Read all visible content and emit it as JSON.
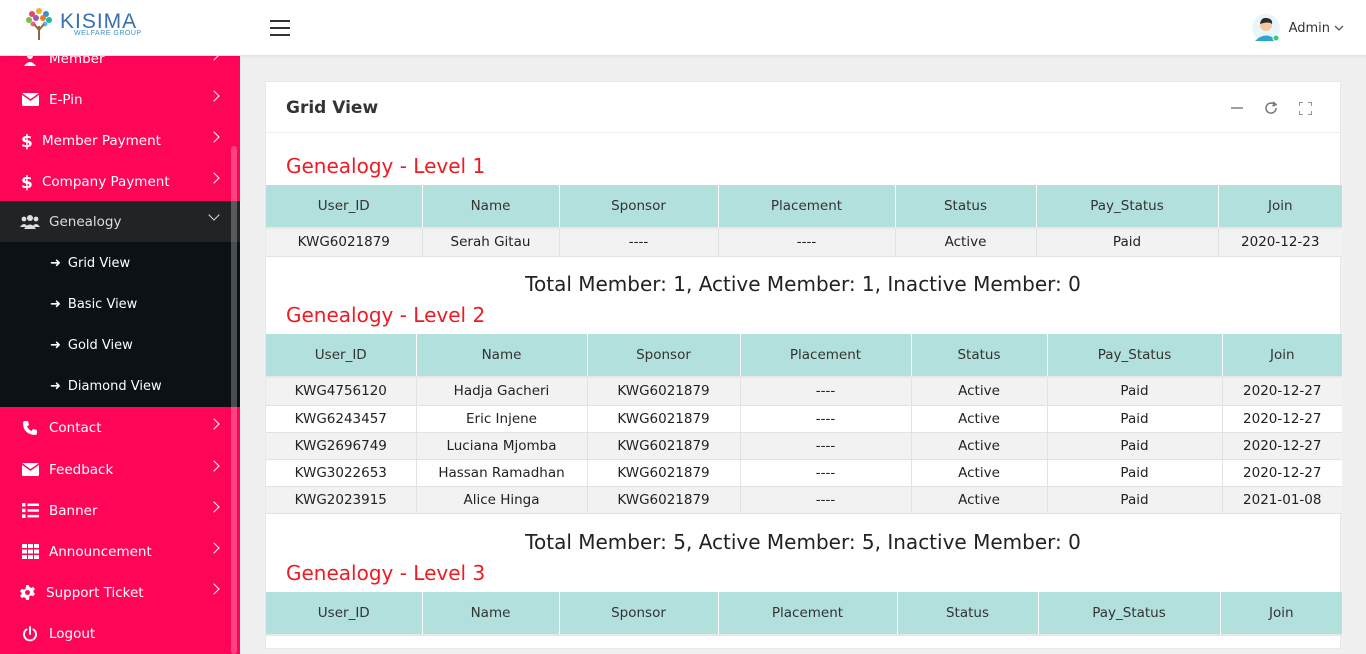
{
  "brand": {
    "name": "KISIMA",
    "tagline": "WELFARE GROUP"
  },
  "header": {
    "user_label": "Admin"
  },
  "sidebar": {
    "items": [
      {
        "label": "Member",
        "icon": "user-icon"
      },
      {
        "label": "E-Pin",
        "icon": "envelope-icon"
      },
      {
        "label": "Member Payment",
        "icon": "dollar-icon"
      },
      {
        "label": "Company Payment",
        "icon": "dollar-icon"
      },
      {
        "label": "Genealogy",
        "icon": "users-icon"
      },
      {
        "label": "Contact",
        "icon": "phone-icon"
      },
      {
        "label": "Feedback",
        "icon": "envelope-icon"
      },
      {
        "label": "Banner",
        "icon": "list-icon"
      },
      {
        "label": "Announcement",
        "icon": "grid-icon"
      },
      {
        "label": "Support Ticket",
        "icon": "gear-icon"
      },
      {
        "label": "Logout",
        "icon": "power-icon"
      }
    ],
    "genealogy_sub": [
      {
        "label": "Grid View"
      },
      {
        "label": "Basic View"
      },
      {
        "label": "Gold View"
      },
      {
        "label": "Diamond View"
      }
    ]
  },
  "card": {
    "title": "Grid View"
  },
  "columns": [
    "User_ID",
    "Name",
    "Sponsor",
    "Placement",
    "Status",
    "Pay_Status",
    "Join"
  ],
  "levels": [
    {
      "title": "Genealogy - Level 1",
      "rows": [
        {
          "user_id": "KWG6021879",
          "name": "Serah Gitau",
          "sponsor": "----",
          "placement": "----",
          "status": "Active",
          "pay_status": "Paid",
          "join": "2020-12-23"
        }
      ],
      "total": "Total Member: 1, Active Member: 1, Inactive Member: 0"
    },
    {
      "title": "Genealogy - Level 2",
      "rows": [
        {
          "user_id": "KWG4756120",
          "name": "Hadja Gacheri",
          "sponsor": "KWG6021879",
          "placement": "----",
          "status": "Active",
          "pay_status": "Paid",
          "join": "2020-12-27"
        },
        {
          "user_id": "KWG6243457",
          "name": "Eric Injene",
          "sponsor": "KWG6021879",
          "placement": "----",
          "status": "Active",
          "pay_status": "Paid",
          "join": "2020-12-27"
        },
        {
          "user_id": "KWG2696749",
          "name": "Luciana Mjomba",
          "sponsor": "KWG6021879",
          "placement": "----",
          "status": "Active",
          "pay_status": "Paid",
          "join": "2020-12-27"
        },
        {
          "user_id": "KWG3022653",
          "name": "Hassan Ramadhan",
          "sponsor": "KWG6021879",
          "placement": "----",
          "status": "Active",
          "pay_status": "Paid",
          "join": "2020-12-27"
        },
        {
          "user_id": "KWG2023915",
          "name": "Alice Hinga",
          "sponsor": "KWG6021879",
          "placement": "----",
          "status": "Active",
          "pay_status": "Paid",
          "join": "2021-01-08"
        }
      ],
      "total": "Total Member: 5, Active Member: 5, Inactive Member: 0"
    },
    {
      "title": "Genealogy - Level 3",
      "rows": []
    }
  ]
}
